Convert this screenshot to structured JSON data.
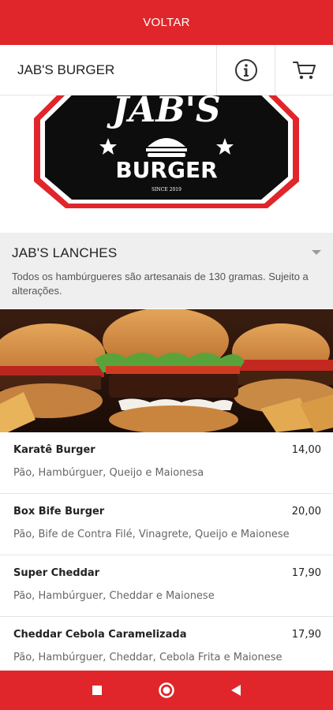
{
  "topbar": {
    "back_label": "VOLTAR"
  },
  "header": {
    "store_name": "JAB'S BURGER",
    "info_icon": "info-icon",
    "cart_icon": "cart-icon"
  },
  "banner": {
    "logo_line1": "JAB'S",
    "logo_line2": "BURGER",
    "logo_since": "SINCE 2019"
  },
  "category": {
    "title": "JAB'S LANCHES",
    "description": "Todos os hambúrgueres são artesanais de 130 gramas. Sujeito a alterações."
  },
  "items": [
    {
      "name": "Karatê Burger",
      "price": "14,00",
      "description": "Pão, Hambúrguer, Queijo e Maionesa"
    },
    {
      "name": "Box Bife Burger",
      "price": "20,00",
      "description": "Pão, Bife de Contra Filé, Vinagrete, Queijo e Maionese"
    },
    {
      "name": "Super Cheddar",
      "price": "17,90",
      "description": "Pão, Hambúrguer, Cheddar e Maionese"
    },
    {
      "name": "Cheddar Cebola Caramelizada",
      "price": "17,90",
      "description": "Pão, Hambúrguer, Cheddar, Cebola Frita e Maionese"
    }
  ],
  "colors": {
    "brand_red": "#e0262b",
    "category_bg": "#efefef"
  },
  "navbar": {
    "icons": [
      "square-icon",
      "circle-icon",
      "triangle-back-icon"
    ]
  }
}
